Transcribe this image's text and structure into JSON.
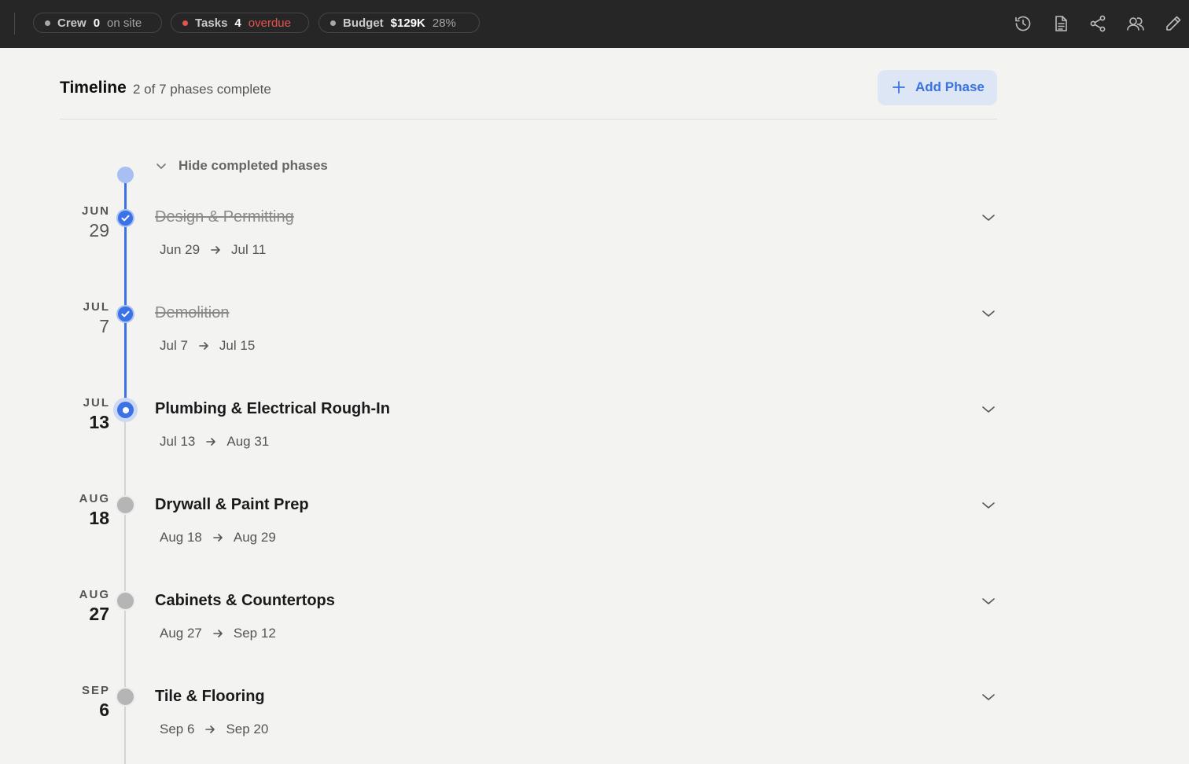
{
  "topbar": {
    "crew": {
      "label": "Crew",
      "value": "0",
      "suffix": "on site"
    },
    "tasks": {
      "label": "Tasks",
      "value": "4",
      "suffix": "overdue",
      "status_color": "#e4544f"
    },
    "budget": {
      "label": "Budget",
      "value": "$129K",
      "suffix": "28%"
    },
    "icons": [
      "history-icon",
      "document-icon",
      "share-icon",
      "team-icon",
      "edit-icon"
    ]
  },
  "header": {
    "title": "Timeline",
    "subtitle": "2 of 7 phases complete",
    "add_button_label": "Add Phase"
  },
  "timeline": {
    "hide_completed_label": "Hide completed phases",
    "accent_color": "#3c72e8",
    "phases": [
      {
        "month": "JUN",
        "day": "29",
        "name": "Design & Permitting",
        "start": "Jun 29",
        "end": "Jul 11",
        "status": "complete"
      },
      {
        "month": "JUL",
        "day": "7",
        "name": "Demolition",
        "start": "Jul 7",
        "end": "Jul 15",
        "status": "complete"
      },
      {
        "month": "JUL",
        "day": "13",
        "name": "Plumbing & Electrical Rough-In",
        "start": "Jul 13",
        "end": "Aug 31",
        "status": "in-progress"
      },
      {
        "month": "AUG",
        "day": "18",
        "name": "Drywall & Paint Prep",
        "start": "Aug 18",
        "end": "Aug 29",
        "status": "upcoming"
      },
      {
        "month": "AUG",
        "day": "27",
        "name": "Cabinets & Countertops",
        "start": "Aug 27",
        "end": "Sep 12",
        "status": "upcoming"
      },
      {
        "month": "SEP",
        "day": "6",
        "name": "Tile & Flooring",
        "start": "Sep 6",
        "end": "Sep 20",
        "status": "upcoming"
      }
    ]
  }
}
